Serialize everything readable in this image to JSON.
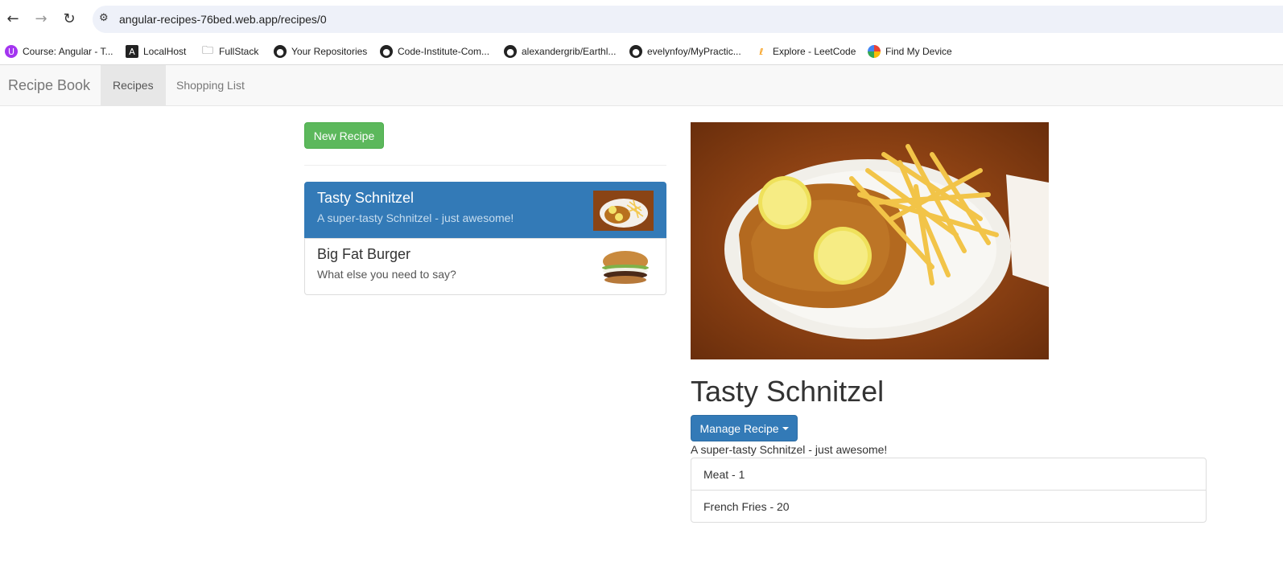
{
  "browser": {
    "url": "angular-recipes-76bed.web.app/recipes/0",
    "bookmarks": [
      {
        "label": "Course: Angular - T...",
        "icon": "udemy-icon",
        "color": "#a435f0"
      },
      {
        "label": "LocalHost",
        "icon": "angular-icon",
        "color": "#222222"
      },
      {
        "label": "FullStack",
        "icon": "folder-icon",
        "color": "#555555"
      },
      {
        "label": "Your Repositories",
        "icon": "github-icon",
        "color": "#222222"
      },
      {
        "label": "Code-Institute-Com...",
        "icon": "github-icon",
        "color": "#222222"
      },
      {
        "label": "alexandergrib/Earthl...",
        "icon": "github-icon",
        "color": "#222222"
      },
      {
        "label": "evelynfoy/MyPractic...",
        "icon": "github-icon",
        "color": "#222222"
      },
      {
        "label": "Explore - LeetCode",
        "icon": "leetcode-icon",
        "color": "#f89f1b"
      },
      {
        "label": "Find My Device",
        "icon": "find-device-icon",
        "color": "#4285f4"
      }
    ]
  },
  "navbar": {
    "brand": "Recipe Book",
    "items": [
      {
        "label": "Recipes",
        "active": true
      },
      {
        "label": "Shopping List",
        "active": false
      }
    ]
  },
  "recipe_list": {
    "new_button": "New Recipe",
    "items": [
      {
        "name": "Tasty Schnitzel",
        "description": "A super-tasty Schnitzel - just awesome!",
        "selected": true
      },
      {
        "name": "Big Fat Burger",
        "description": "What else you need to say?",
        "selected": false
      }
    ]
  },
  "detail": {
    "name": "Tasty Schnitzel",
    "manage_button": "Manage Recipe",
    "description": "A super-tasty Schnitzel - just awesome!",
    "ingredients": [
      "Meat - 1",
      "French Fries - 20"
    ]
  },
  "colors": {
    "primary": "#337ab7",
    "success": "#5cb85c"
  }
}
